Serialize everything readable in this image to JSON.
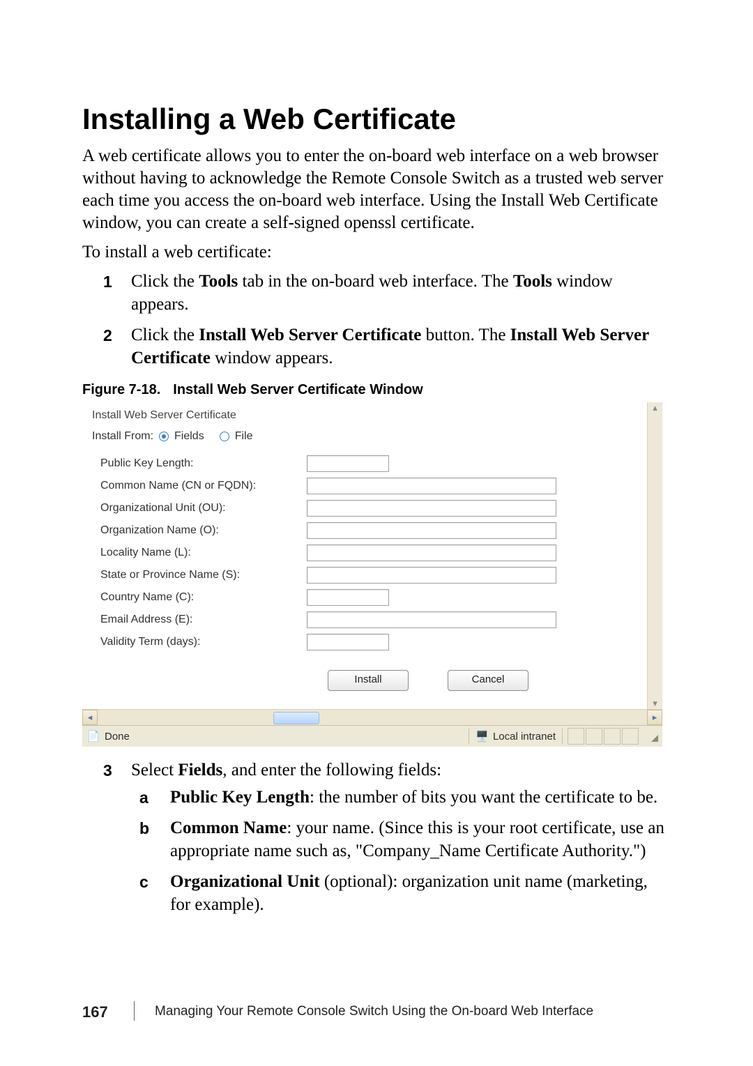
{
  "heading": "Installing a Web Certificate",
  "paragraphs": {
    "intro": "A web certificate allows you to enter the on-board web interface on a web browser without having to acknowledge the Remote Console Switch as a trusted web server each time you access the on-board web interface. Using the Install Web Certificate window, you can create a self-signed openssl certificate.",
    "toinstall": "To install a web certificate:"
  },
  "steps1": [
    {
      "marker": "1",
      "pre": "Click the ",
      "bold1": "Tools",
      "mid": " tab in the on-board web interface. The ",
      "bold2": "Tools",
      "post": " window appears."
    },
    {
      "marker": "2",
      "pre": "Click the ",
      "bold1": "Install Web Server Certificate",
      "mid": " button. The ",
      "bold2": "Install Web Server Certificate",
      "post": " window appears."
    }
  ],
  "figure_caption": {
    "label": "Figure 7-18.",
    "title": "Install Web Server Certificate Window"
  },
  "screenshot": {
    "subheader": "Install Web Server Certificate",
    "install_from_label": "Install From:",
    "radio_fields": "Fields",
    "radio_file": "File",
    "fields": [
      "Public Key Length:",
      "Common Name (CN or FQDN):",
      "Organizational Unit (OU):",
      "Organization Name (O):",
      "Locality Name (L):",
      "State or Province Name (S):",
      "Country Name (C):",
      "Email Address (E):",
      "Validity Term (days):"
    ],
    "install_btn": "Install",
    "cancel_btn": "Cancel",
    "status_done": "Done",
    "status_zone": "Local intranet"
  },
  "steps2": [
    {
      "marker": "3",
      "pre": "Select ",
      "bold1": "Fields",
      "post": ", and enter the following fields:",
      "sub": [
        {
          "marker": "a",
          "bold": "Public Key Length",
          "text": ": the number of bits you want the certificate to be."
        },
        {
          "marker": "b",
          "bold": "Common Name",
          "text": ": your name. (Since this is your root certificate, use an appropriate name such as, \"Company_Name Certificate Authority.\")"
        },
        {
          "marker": "c",
          "bold": "Organizational Unit",
          "text": " (optional): organization unit name (marketing, for example)."
        }
      ]
    }
  ],
  "footer": {
    "page": "167",
    "chapter": "Managing Your Remote Console Switch Using the On-board Web Interface"
  }
}
